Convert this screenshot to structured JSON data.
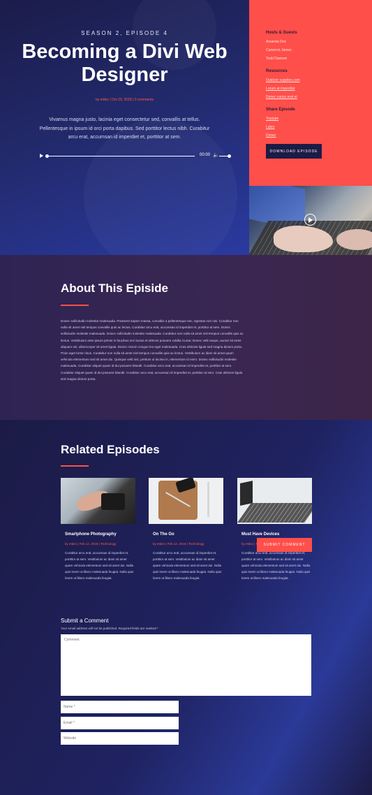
{
  "hero": {
    "eyebrow": "SEASON 2, EPISODE 4",
    "title": "Becoming a Divi Web Designer",
    "meta_author": "by etdev",
    "meta_date": "Oct 29, 2018",
    "meta_comments": "0 comments",
    "meta_sep": "|",
    "description": "Vivamus magna justo, lacinia eget consectetur sed, convallis at tellus. Pellentesque in ipsum id orci porta dapibus. Sed porttitor lectus nibh. Curabitur arcu erat, accumsan id imperdiet et, porttitor at sem.",
    "player": {
      "time": "00:00",
      "play_icon": "play-icon",
      "volume_icon": "volume-icon",
      "progress": 0.0,
      "volume": 0.85
    }
  },
  "sidebar": {
    "hosts_heading": "Hosts & Guests",
    "hosts": [
      "Amanda Dox",
      "Cameron James",
      "Todd Dawson"
    ],
    "resources_heading": "Resources",
    "resources": [
      "Outdoor supplies.com",
      "Lorum at imperdiet",
      "Donec varius erat et"
    ],
    "share_heading": "Share Episode",
    "share": [
      "Youtube",
      "Lateo",
      "Donec"
    ],
    "download_label": "DOWNLOAD EPISODE"
  },
  "video": {
    "play_icon": "play-circle-icon"
  },
  "about": {
    "title": "About This Episide",
    "body": "Donec sollicitudin molestie malesuada. Praesent sapien massa, convallis a pellentesque nec, egestas non nisi. Curabitur non nulla sit amet nisl tempus convallis quis ac lectus. Curabitur arcu erat, accumsan id imperdiet et, porttitor at sem. Donec sollicitudin molestie malesuada. Donec sollicitudin molestie malesuada. Curabitur non nulla sit amet nisl tempus convallis quis ac lectus. Vestibulum ante ipsum primis in faucibus orci luctus et ultrices posuere cubilia Curae; Donec velit neque, auctor sit amet aliquam vel, ullamcorper sit amet ligula. Donec rutrum congue leo eget malesuada. Cras ultricies ligula sed magna dictum porta. Proin eget tortor risus. Curabitur non nulla sit amet nisl tempus convallis quis ac lectus. Vestibulum ac diam sit amet quam vehicula elementum sed sit amet dui. Quisque velit nisi, pretium ut lacinia in, elementum id enim. Donec sollicitudin molestie malesuada. Curabitur aliquet quam id dui posuere blandit. Curabitur arcu erat, accumsan id imperdiet et, porttitor at sem. Curabitur aliquet quam id dui posuere blandit. Curabitur arcu erat, accumsan id imperdiet et, porttitor at sem. Cras ultricies ligula sed magna dictum porta."
  },
  "related": {
    "title": "Related Episodes",
    "cards": [
      {
        "title": "Smartphone Photography",
        "author": "by etdev",
        "date": "Feb 12, 2018",
        "category": "Technology",
        "body": "Curabitur arcu erat, accumsan id imperdiet et, porttitor at sem. Vestibulum ac diam sit amet quam vehicula elementum sed sit amet dui. Nulla quis lorem ut libero malesuada feugiat. Nulla quis lorem ut libero malesuada feugiat."
      },
      {
        "title": "On The Go",
        "author": "by etdev",
        "date": "Feb 12, 2018",
        "category": "Technology",
        "body": "Curabitur arcu erat, accumsan id imperdiet et, porttitor at sem. Vestibulum ac diam sit amet quam vehicula elementum sed sit amet dui. Nulla quis lorem ut libero malesuada feugiat. Nulla quis lorem ut libero malesuada feugiat."
      },
      {
        "title": "Must Have Devices",
        "author": "by etdev",
        "date": "Feb 12, 2018",
        "category": "Technology",
        "body": "Curabitur arcu erat, accumsan id imperdiet et, porttitor at sem. Vestibulum ac diam sit amet quam vehicula elementum sed sit amet dui. Nulla quis lorem ut libero malesuada feugiat. Nulla quis lorem ut libero malesuada feugiat."
      }
    ]
  },
  "comment_form": {
    "title": "Submit a Comment",
    "note": "Your email address will not be published. Required fields are marked *",
    "comment_placeholder": "Comment",
    "name_placeholder": "Name *",
    "email_placeholder": "Email *",
    "website_placeholder": "Website",
    "submit_label": "SUBMIT COMMENT"
  },
  "colors": {
    "accent": "#ff4f4a",
    "navy": "#1c1b46",
    "royal_blue": "#2a3aa0"
  }
}
